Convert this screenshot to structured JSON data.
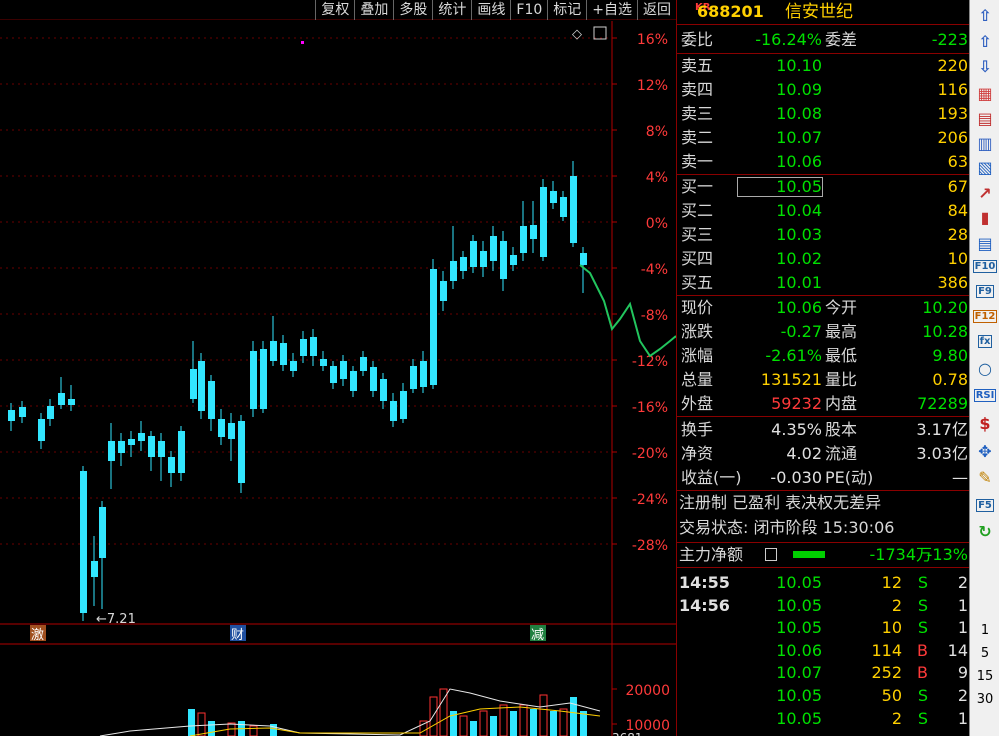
{
  "toolbar": {
    "buttons": [
      "复权",
      "叠加",
      "多股",
      "统计",
      "画线",
      "F10",
      "标记",
      "+自选",
      "返回"
    ]
  },
  "chart": {
    "price_axis": [
      "16%",
      "12%",
      "8%",
      "4%",
      "0%",
      "-4%",
      "-8%",
      "-12%",
      "-16%",
      "-20%",
      "-24%",
      "-28%"
    ],
    "volume_axis": [
      "20000",
      "10000"
    ],
    "low_marker": "←7.21",
    "event_markers": [
      "激",
      "财",
      "减"
    ],
    "bottom_value": "3681",
    "colors": {
      "up": "#ff3232",
      "down": "#32e6ff",
      "intraday": "#22c55e"
    }
  },
  "quote": {
    "kr_tag": "KR",
    "code": "688201",
    "name": "信安世纪",
    "weibi_label": "委比",
    "weibi": "-16.24%",
    "weicha_label": "委差",
    "weicha": "-223",
    "asks": [
      {
        "label": "卖五",
        "price": "10.10",
        "vol": "220"
      },
      {
        "label": "卖四",
        "price": "10.09",
        "vol": "116"
      },
      {
        "label": "卖三",
        "price": "10.08",
        "vol": "193"
      },
      {
        "label": "卖二",
        "price": "10.07",
        "vol": "206"
      },
      {
        "label": "卖一",
        "price": "10.06",
        "vol": "63"
      }
    ],
    "bids": [
      {
        "label": "买一",
        "price": "10.05",
        "vol": "67"
      },
      {
        "label": "买二",
        "price": "10.04",
        "vol": "84"
      },
      {
        "label": "买三",
        "price": "10.03",
        "vol": "28"
      },
      {
        "label": "买四",
        "price": "10.02",
        "vol": "10"
      },
      {
        "label": "买五",
        "price": "10.01",
        "vol": "386"
      }
    ],
    "stats": [
      {
        "l1": "现价",
        "v1": "10.06",
        "c1": "g",
        "l2": "今开",
        "v2": "10.20",
        "c2": "g"
      },
      {
        "l1": "涨跌",
        "v1": "-0.27",
        "c1": "g",
        "l2": "最高",
        "v2": "10.28",
        "c2": "g"
      },
      {
        "l1": "涨幅",
        "v1": "-2.61%",
        "c1": "g",
        "l2": "最低",
        "v2": "9.80",
        "c2": "g"
      },
      {
        "l1": "总量",
        "v1": "131521",
        "c1": "y",
        "l2": "量比",
        "v2": "0.78",
        "c2": "y"
      },
      {
        "l1": "外盘",
        "v1": "59232",
        "c1": "r",
        "l2": "内盘",
        "v2": "72289",
        "c2": "g"
      }
    ],
    "fund": [
      {
        "l1": "换手",
        "v1": "4.35%",
        "l2": "股本",
        "v2": "3.17亿"
      },
      {
        "l1": "净资",
        "v1": "4.02",
        "l2": "流通",
        "v2": "3.03亿"
      },
      {
        "l1": "收益(一)",
        "v1": "-0.030",
        "l2": "PE(动)",
        "v2": "—"
      }
    ],
    "reg_info": "注册制 已盈利 表决权无差异",
    "trade_status": "交易状态: 闭市阶段 15:30:06",
    "main_flow_label": "主力净额",
    "main_flow_value": "-1734万",
    "main_flow_pct": "-13%",
    "ticks": [
      {
        "time": "14:55",
        "price": "10.05",
        "vol": "12",
        "side": "S",
        "num": "2"
      },
      {
        "time": "14:56",
        "price": "10.05",
        "vol": "2",
        "side": "S",
        "num": "1"
      },
      {
        "time": "",
        "price": "10.05",
        "vol": "10",
        "side": "S",
        "num": "1"
      },
      {
        "time": "",
        "price": "10.06",
        "vol": "114",
        "side": "B",
        "num": "14"
      },
      {
        "time": "",
        "price": "10.07",
        "vol": "252",
        "side": "B",
        "num": "9"
      },
      {
        "time": "",
        "price": "10.05",
        "vol": "50",
        "side": "S",
        "num": "2"
      },
      {
        "time": "",
        "price": "10.05",
        "vol": "2",
        "side": "S",
        "num": "1"
      }
    ]
  },
  "sidebar": {
    "icons": [
      "up-arrow-icon",
      "double-up-icon",
      "double-down-icon",
      "chart-icon",
      "grid-icon",
      "list-icon",
      "table-icon",
      "line-chart-icon",
      "bar-chart-icon",
      "doc-icon",
      "f10-icon",
      "f9-icon",
      "f12-icon",
      "fx-icon",
      "circle-icon",
      "rsi-icon",
      "dollar-icon",
      "move-icon",
      "pen-icon",
      "f5-icon",
      "refresh-icon"
    ],
    "labels": {
      "rsi": "RSI",
      "f5": "F5",
      "f10": "F10",
      "f12": "F12",
      "fx": "fx"
    },
    "numbers": [
      "1",
      "5",
      "15",
      "30"
    ]
  }
}
